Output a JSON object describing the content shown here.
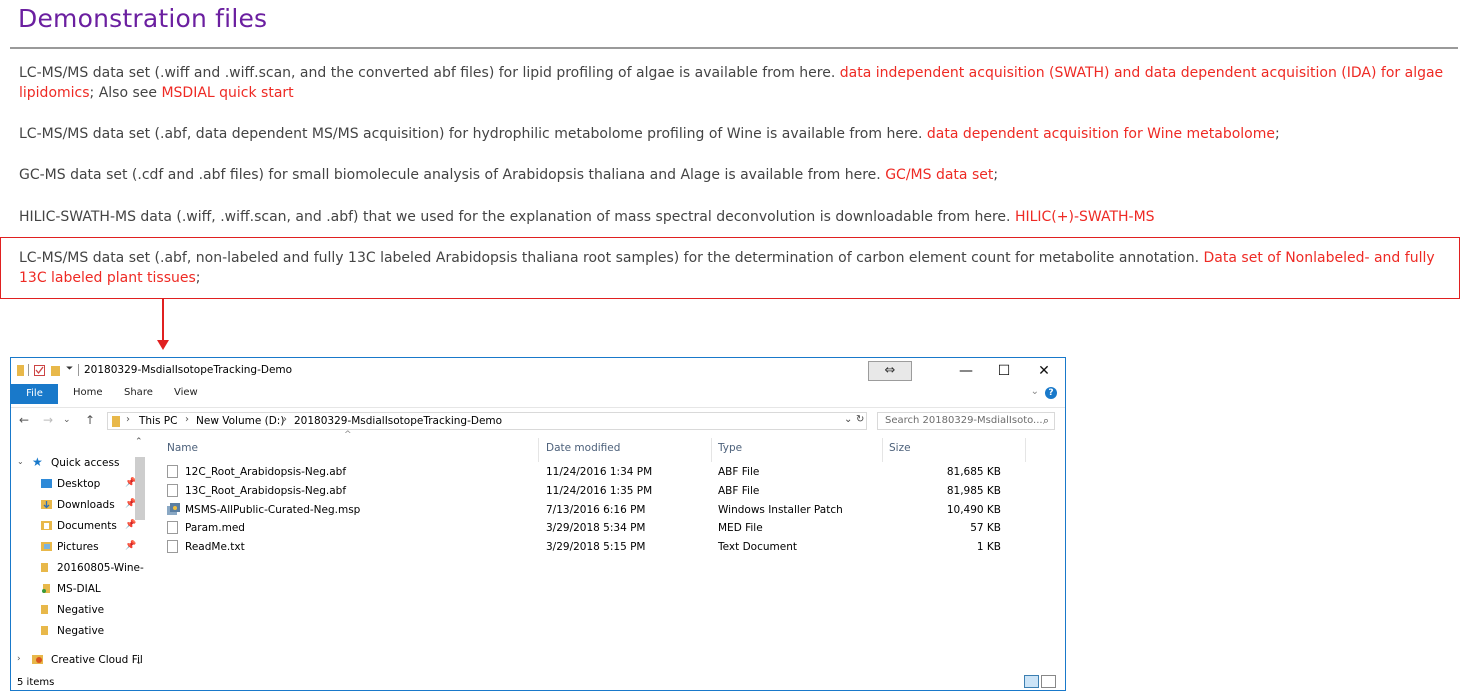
{
  "page": {
    "title": "Demonstration files",
    "paragraphs": [
      {
        "text": "LC-MS/MS data set (.wiff and .wiff.scan, and the converted abf files) for lipid profiling of algae is available from here. ",
        "link": "data independent acquisition (SWATH) and data dependent acquisition (IDA) for algae lipidomics",
        "text2": "; Also see ",
        "link2": "MSDIAL quick start"
      },
      {
        "text": "LC-MS/MS data set (.abf, data dependent MS/MS acquisition) for hydrophilic metabolome profiling of Wine is available from here. ",
        "link": "data dependent acquisition for Wine metabolome",
        "text2": ";"
      },
      {
        "text": "GC-MS data set (.cdf and .abf files) for small biomolecule analysis of Arabidopsis thaliana and Alage is available from here. ",
        "link": "GC/MS data set",
        "text2": ";"
      },
      {
        "text": "HILIC-SWATH-MS data (.wiff, .wiff.scan, and .abf) that we used for the explanation of mass spectral deconvolution is downloadable from here. ",
        "link": "HILIC(+)-SWATH-MS",
        "text2": ""
      },
      {
        "text": "LC-MS/MS data set (.abf, non-labeled and fully 13C labeled Arabidopsis thaliana root samples) for the determination of carbon element count for metabolite annotation. ",
        "link": "Data set of Nonlabeled- and fully 13C labeled plant tissues",
        "text2": ";"
      }
    ]
  },
  "explorer": {
    "window_title": "20180329-MsdialIsotopeTracking-Demo",
    "window_controls": {
      "swap": "⇔",
      "minimize": "—",
      "maximize": "☐",
      "close": "✕"
    },
    "ribbon": {
      "file": "File",
      "home": "Home",
      "share": "Share",
      "view": "View",
      "help": "?"
    },
    "address": {
      "crumbs": [
        "This PC",
        "New Volume (D:)",
        "20180329-MsdialIsotopeTracking-Demo"
      ],
      "dropdown": "⌄",
      "refresh": "↻"
    },
    "search": {
      "placeholder": "Search 20180329-MsdialIsoto..."
    },
    "nav": [
      {
        "label": "Quick access",
        "icon": "star-icon"
      },
      {
        "label": "Desktop",
        "icon": "folder-icon",
        "pinned": true
      },
      {
        "label": "Downloads",
        "icon": "download-folder-icon",
        "pinned": true
      },
      {
        "label": "Documents",
        "icon": "documents-folder-icon",
        "pinned": true
      },
      {
        "label": "Pictures",
        "icon": "pictures-folder-icon",
        "pinned": true
      },
      {
        "label": "20160805-Wine-",
        "icon": "folder-icon"
      },
      {
        "label": "MS-DIAL",
        "icon": "folder-icon"
      },
      {
        "label": "Negative",
        "icon": "folder-icon"
      },
      {
        "label": "Negative",
        "icon": "folder-icon"
      },
      {
        "label": "Creative Cloud Fil",
        "icon": "creative-cloud-icon"
      }
    ],
    "columns": {
      "name": "Name",
      "date": "Date modified",
      "type": "Type",
      "size": "Size"
    },
    "files": [
      {
        "name": "12C_Root_Arabidopsis-Neg.abf",
        "date": "11/24/2016 1:34 PM",
        "type": "ABF File",
        "size": "81,685 KB",
        "icon": "file-icon"
      },
      {
        "name": "13C_Root_Arabidopsis-Neg.abf",
        "date": "11/24/2016 1:35 PM",
        "type": "ABF File",
        "size": "81,985 KB",
        "icon": "file-icon"
      },
      {
        "name": "MSMS-AllPublic-Curated-Neg.msp",
        "date": "7/13/2016 6:16 PM",
        "type": "Windows Installer Patch",
        "size": "10,490 KB",
        "icon": "installer-patch-icon"
      },
      {
        "name": "Param.med",
        "date": "3/29/2018 5:34 PM",
        "type": "MED File",
        "size": "57 KB",
        "icon": "file-icon"
      },
      {
        "name": "ReadMe.txt",
        "date": "3/29/2018 5:15 PM",
        "type": "Text Document",
        "size": "1 KB",
        "icon": "text-file-icon"
      }
    ],
    "status": "5 items"
  },
  "colors": {
    "title": "#6b1fa0",
    "link": "#ee2a24",
    "highlight": "#e02020",
    "accent": "#1979ca"
  }
}
